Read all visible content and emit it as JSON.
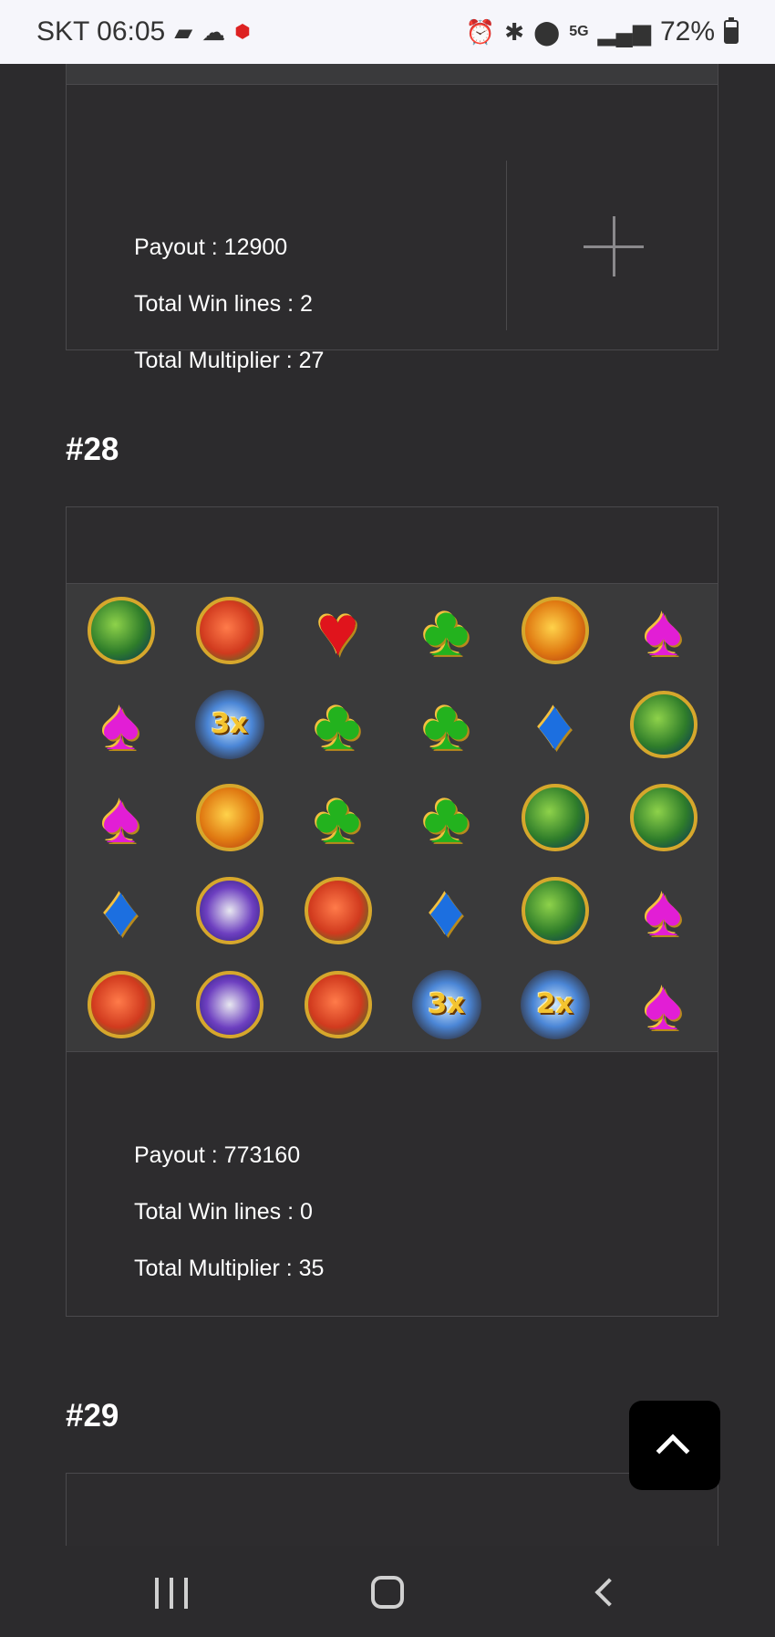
{
  "status_bar": {
    "carrier_time": "SKT 06:05",
    "battery_percent": "72%",
    "icons_left": [
      "card-icon",
      "cloud-icon",
      "app-icon"
    ],
    "icons_right": [
      "alarm-icon",
      "bluetooth-icon",
      "location-icon",
      "5g-icon",
      "signal-icon",
      "battery-icon"
    ]
  },
  "top_card": {
    "payout": "Payout : 12900",
    "win_lines": "Total Win lines : 2",
    "multiplier": "Total Multiplier : 27",
    "expand_icon": "plus-icon"
  },
  "spin_28": {
    "title": "#28",
    "grid": [
      [
        "fish-green",
        "fish-red",
        "heart",
        "club",
        "fish-orange",
        "spade"
      ],
      [
        "spade",
        "wild-3x",
        "club",
        "club",
        "diamond",
        "fish-green"
      ],
      [
        "spade",
        "fish-orange",
        "club",
        "club",
        "fish-green",
        "fish-green"
      ],
      [
        "diamond",
        "fish-purple",
        "fish-red",
        "diamond",
        "fish-green",
        "spade"
      ],
      [
        "fish-red",
        "fish-purple",
        "fish-red",
        "wild-3x",
        "wild-2x",
        "spade"
      ]
    ],
    "wild_labels": {
      "wild-3x": "3x",
      "wild-2x": "2x"
    },
    "payout": "Payout : 773160",
    "win_lines": "Total Win lines : 0",
    "multiplier": "Total Multiplier : 35"
  },
  "spin_29": {
    "title": "#29"
  },
  "back_to_top": {
    "icon": "chevron-up-icon"
  },
  "nav": {
    "recents": "recents-icon",
    "home": "home-icon",
    "back": "back-icon"
  }
}
